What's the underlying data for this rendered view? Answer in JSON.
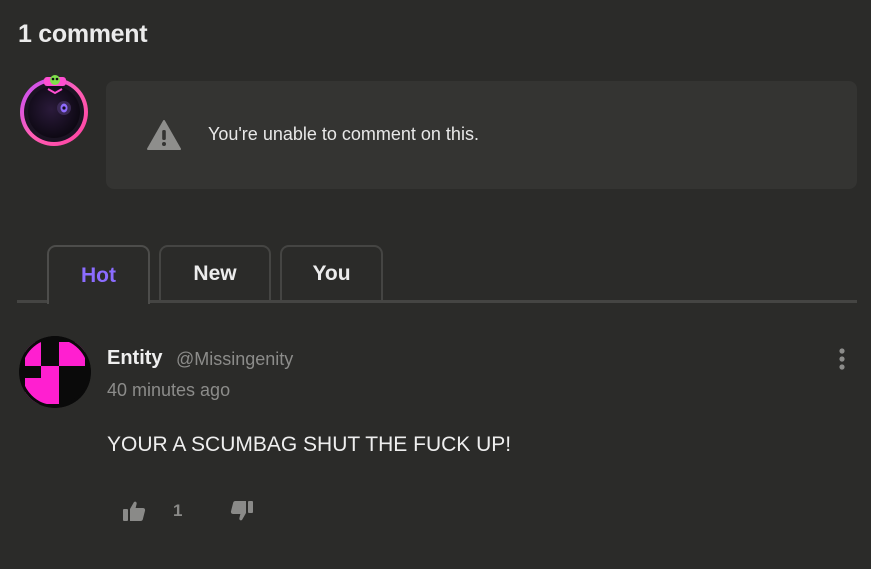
{
  "header": {
    "comment_count_label": "1 comment"
  },
  "notice": {
    "icon": "warning-icon",
    "message": "You're unable to comment on this."
  },
  "tabs": [
    {
      "label": "Hot",
      "active": true
    },
    {
      "label": "New",
      "active": false
    },
    {
      "label": "You",
      "active": false
    }
  ],
  "comments": [
    {
      "author_name": "Entity",
      "author_handle": "@Missingenity",
      "time": "40 minutes ago",
      "text": "YOUR A SCUMBAG SHUT THE FUCK UP!",
      "likes": "1"
    }
  ],
  "colors": {
    "background": "#2b2b29",
    "panel": "#343432",
    "accent_active_tab": "#8b6cff",
    "muted_text": "#8c8c8a",
    "avatar_pink": "#ff1fd0"
  }
}
